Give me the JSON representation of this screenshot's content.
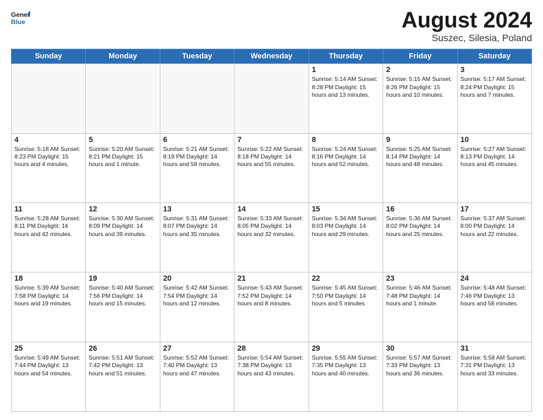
{
  "header": {
    "logo_line1": "General",
    "logo_line2": "Blue",
    "month_year": "August 2024",
    "location": "Suszec, Silesia, Poland"
  },
  "weekdays": [
    "Sunday",
    "Monday",
    "Tuesday",
    "Wednesday",
    "Thursday",
    "Friday",
    "Saturday"
  ],
  "weeks": [
    [
      {
        "day": "",
        "text": ""
      },
      {
        "day": "",
        "text": ""
      },
      {
        "day": "",
        "text": ""
      },
      {
        "day": "",
        "text": ""
      },
      {
        "day": "1",
        "text": "Sunrise: 5:14 AM\nSunset: 8:28 PM\nDaylight: 15 hours\nand 13 minutes."
      },
      {
        "day": "2",
        "text": "Sunrise: 5:15 AM\nSunset: 8:26 PM\nDaylight: 15 hours\nand 10 minutes."
      },
      {
        "day": "3",
        "text": "Sunrise: 5:17 AM\nSunset: 8:24 PM\nDaylight: 15 hours\nand 7 minutes."
      }
    ],
    [
      {
        "day": "4",
        "text": "Sunrise: 5:18 AM\nSunset: 8:23 PM\nDaylight: 15 hours\nand 4 minutes."
      },
      {
        "day": "5",
        "text": "Sunrise: 5:20 AM\nSunset: 8:21 PM\nDaylight: 15 hours\nand 1 minute."
      },
      {
        "day": "6",
        "text": "Sunrise: 5:21 AM\nSunset: 8:19 PM\nDaylight: 14 hours\nand 58 minutes."
      },
      {
        "day": "7",
        "text": "Sunrise: 5:22 AM\nSunset: 8:18 PM\nDaylight: 14 hours\nand 55 minutes."
      },
      {
        "day": "8",
        "text": "Sunrise: 5:24 AM\nSunset: 8:16 PM\nDaylight: 14 hours\nand 52 minutes."
      },
      {
        "day": "9",
        "text": "Sunrise: 5:25 AM\nSunset: 8:14 PM\nDaylight: 14 hours\nand 48 minutes."
      },
      {
        "day": "10",
        "text": "Sunrise: 5:27 AM\nSunset: 8:13 PM\nDaylight: 14 hours\nand 45 minutes."
      }
    ],
    [
      {
        "day": "11",
        "text": "Sunrise: 5:28 AM\nSunset: 8:11 PM\nDaylight: 14 hours\nand 42 minutes."
      },
      {
        "day": "12",
        "text": "Sunrise: 5:30 AM\nSunset: 8:09 PM\nDaylight: 14 hours\nand 39 minutes."
      },
      {
        "day": "13",
        "text": "Sunrise: 5:31 AM\nSunset: 8:07 PM\nDaylight: 14 hours\nand 35 minutes."
      },
      {
        "day": "14",
        "text": "Sunrise: 5:33 AM\nSunset: 8:05 PM\nDaylight: 14 hours\nand 32 minutes."
      },
      {
        "day": "15",
        "text": "Sunrise: 5:34 AM\nSunset: 8:03 PM\nDaylight: 14 hours\nand 29 minutes."
      },
      {
        "day": "16",
        "text": "Sunrise: 5:36 AM\nSunset: 8:02 PM\nDaylight: 14 hours\nand 25 minutes."
      },
      {
        "day": "17",
        "text": "Sunrise: 5:37 AM\nSunset: 8:00 PM\nDaylight: 14 hours\nand 22 minutes."
      }
    ],
    [
      {
        "day": "18",
        "text": "Sunrise: 5:39 AM\nSunset: 7:58 PM\nDaylight: 14 hours\nand 19 minutes."
      },
      {
        "day": "19",
        "text": "Sunrise: 5:40 AM\nSunset: 7:56 PM\nDaylight: 14 hours\nand 15 minutes."
      },
      {
        "day": "20",
        "text": "Sunrise: 5:42 AM\nSunset: 7:54 PM\nDaylight: 14 hours\nand 12 minutes."
      },
      {
        "day": "21",
        "text": "Sunrise: 5:43 AM\nSunset: 7:52 PM\nDaylight: 14 hours\nand 8 minutes."
      },
      {
        "day": "22",
        "text": "Sunrise: 5:45 AM\nSunset: 7:50 PM\nDaylight: 14 hours\nand 5 minutes."
      },
      {
        "day": "23",
        "text": "Sunrise: 5:46 AM\nSunset: 7:48 PM\nDaylight: 14 hours\nand 1 minute."
      },
      {
        "day": "24",
        "text": "Sunrise: 5:48 AM\nSunset: 7:46 PM\nDaylight: 13 hours\nand 58 minutes."
      }
    ],
    [
      {
        "day": "25",
        "text": "Sunrise: 5:49 AM\nSunset: 7:44 PM\nDaylight: 13 hours\nand 54 minutes."
      },
      {
        "day": "26",
        "text": "Sunrise: 5:51 AM\nSunset: 7:42 PM\nDaylight: 13 hours\nand 51 minutes."
      },
      {
        "day": "27",
        "text": "Sunrise: 5:52 AM\nSunset: 7:40 PM\nDaylight: 13 hours\nand 47 minutes."
      },
      {
        "day": "28",
        "text": "Sunrise: 5:54 AM\nSunset: 7:38 PM\nDaylight: 13 hours\nand 43 minutes."
      },
      {
        "day": "29",
        "text": "Sunrise: 5:55 AM\nSunset: 7:35 PM\nDaylight: 13 hours\nand 40 minutes."
      },
      {
        "day": "30",
        "text": "Sunrise: 5:57 AM\nSunset: 7:33 PM\nDaylight: 13 hours\nand 36 minutes."
      },
      {
        "day": "31",
        "text": "Sunrise: 5:58 AM\nSunset: 7:31 PM\nDaylight: 13 hours\nand 33 minutes."
      }
    ]
  ]
}
